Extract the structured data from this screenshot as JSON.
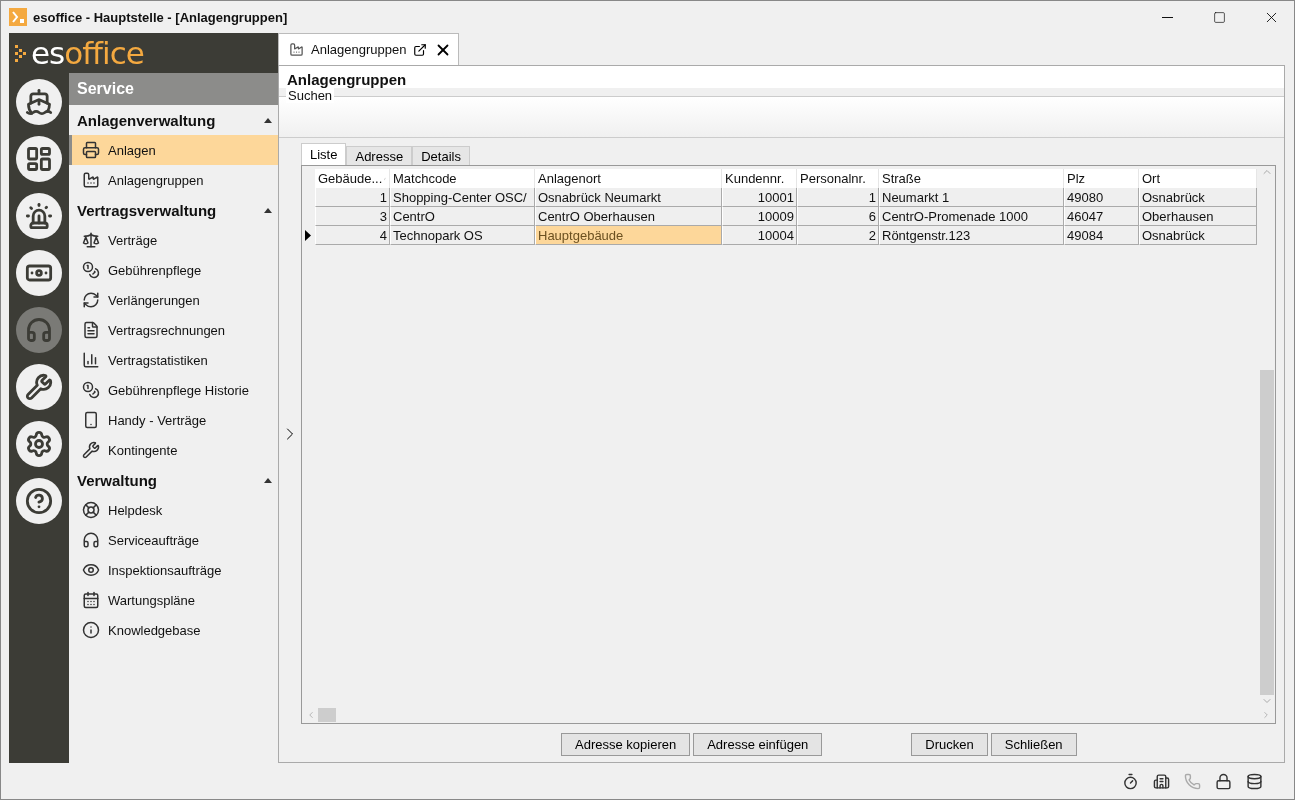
{
  "window": {
    "title": "esoffice - Hauptstelle - [Anlagengruppen]"
  },
  "logo": {
    "first": "es",
    "second": "office"
  },
  "rail": [
    {
      "selected": false
    },
    {
      "selected": false
    },
    {
      "selected": false
    },
    {
      "selected": false
    },
    {
      "selected": true
    },
    {
      "selected": false
    },
    {
      "selected": false
    },
    {
      "selected": false
    }
  ],
  "sidebar": {
    "title": "Service",
    "groups": [
      {
        "label": "Anlagenverwaltung",
        "expanded": true,
        "items": [
          {
            "label": "Anlagen",
            "selected": true
          },
          {
            "label": "Anlagengruppen",
            "selected": false
          }
        ]
      },
      {
        "label": "Vertragsverwaltung",
        "expanded": true,
        "items": [
          {
            "label": "Verträge",
            "selected": false
          },
          {
            "label": "Gebührenpflege",
            "selected": false
          },
          {
            "label": "Verlängerungen",
            "selected": false
          },
          {
            "label": "Vertragsrechnungen",
            "selected": false
          },
          {
            "label": "Vertragstatistiken",
            "selected": false
          },
          {
            "label": "Gebührenpflege Historie",
            "selected": false
          },
          {
            "label": "Handy - Verträge",
            "selected": false
          },
          {
            "label": "Kontingente",
            "selected": false
          }
        ]
      },
      {
        "label": "Verwaltung",
        "expanded": true,
        "items": [
          {
            "label": "Helpdesk",
            "selected": false
          },
          {
            "label": "Serviceaufträge",
            "selected": false
          },
          {
            "label": "Inspektionsaufträge",
            "selected": false
          },
          {
            "label": "Wartungspläne",
            "selected": false
          },
          {
            "label": "Knowledgebase",
            "selected": false
          }
        ]
      }
    ]
  },
  "document_tab": {
    "label": "Anlagengruppen"
  },
  "page": {
    "title": "Anlagengruppen",
    "search_group": "Suchen"
  },
  "tabs": [
    {
      "label": "Liste",
      "selected": true
    },
    {
      "label": "Adresse",
      "selected": false
    },
    {
      "label": "Details",
      "selected": false
    }
  ],
  "table": {
    "columns": [
      {
        "label": "Gebäude...",
        "sorted": true
      },
      {
        "label": "Matchcode",
        "sorted": false
      },
      {
        "label": "Anlagenort",
        "sorted": false
      },
      {
        "label": "Kundennr.",
        "sorted": false
      },
      {
        "label": "Personalnr.",
        "sorted": false
      },
      {
        "label": "Straße",
        "sorted": false
      },
      {
        "label": "Plz",
        "sorted": false
      },
      {
        "label": "Ort",
        "sorted": false
      }
    ],
    "rows": [
      {
        "current": false,
        "cells": [
          {
            "text": "1",
            "selected": false
          },
          {
            "text": "Shopping-Center OSC/",
            "selected": false
          },
          {
            "text": "Osnabrück Neumarkt",
            "selected": false
          },
          {
            "text": "10001",
            "selected": false
          },
          {
            "text": "1",
            "selected": false
          },
          {
            "text": "Neumarkt 1",
            "selected": false
          },
          {
            "text": "49080",
            "selected": false
          },
          {
            "text": "Osnabrück",
            "selected": false
          }
        ]
      },
      {
        "current": false,
        "cells": [
          {
            "text": "3",
            "selected": false
          },
          {
            "text": "CentrO",
            "selected": false
          },
          {
            "text": "CentrO Oberhausen",
            "selected": false
          },
          {
            "text": "10009",
            "selected": false
          },
          {
            "text": "6",
            "selected": false
          },
          {
            "text": "CentrO-Promenade 1000",
            "selected": false
          },
          {
            "text": "46047",
            "selected": false
          },
          {
            "text": "Oberhausen",
            "selected": false
          }
        ]
      },
      {
        "current": true,
        "cells": [
          {
            "text": "4",
            "selected": false
          },
          {
            "text": "Technopark OS",
            "selected": false
          },
          {
            "text": "Hauptgebäude",
            "selected": true
          },
          {
            "text": "10004",
            "selected": false
          },
          {
            "text": "2",
            "selected": false
          },
          {
            "text": "Röntgenstr.123",
            "selected": false
          },
          {
            "text": "49084",
            "selected": false
          },
          {
            "text": "Osnabrück",
            "selected": false
          }
        ]
      }
    ]
  },
  "buttons": [
    {
      "label": "Adresse kopieren"
    },
    {
      "label": "Adresse einfügen"
    },
    {
      "label": "Drucken"
    },
    {
      "label": "Schließen"
    }
  ],
  "status_icons": [
    {
      "disabled": false
    },
    {
      "disabled": false
    },
    {
      "disabled": true
    },
    {
      "disabled": false
    },
    {
      "disabled": false
    }
  ]
}
